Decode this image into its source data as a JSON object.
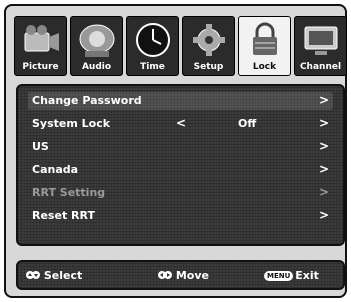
{
  "tabs": [
    {
      "label": "Picture",
      "icon": "picture-icon",
      "active": false
    },
    {
      "label": "Audio",
      "icon": "audio-icon",
      "active": false
    },
    {
      "label": "Time",
      "icon": "clock-icon",
      "active": false
    },
    {
      "label": "Setup",
      "icon": "setup-icon",
      "active": false
    },
    {
      "label": "Lock",
      "icon": "lock-icon",
      "active": true
    },
    {
      "label": "Channel",
      "icon": "channel-icon",
      "active": false
    }
  ],
  "menu": {
    "items": [
      {
        "label": "Change Password",
        "arrow": ">"
      },
      {
        "label": "System Lock",
        "left": "<",
        "value": "Off",
        "arrow": ">"
      },
      {
        "label": "US",
        "arrow": ">"
      },
      {
        "label": "Canada",
        "arrow": ">"
      },
      {
        "label": "RRT Setting",
        "arrow": ">",
        "disabled": true
      },
      {
        "label": "Reset RRT",
        "arrow": ">"
      }
    ]
  },
  "footer": {
    "select_label": "Select",
    "move_label": "Move",
    "menu_badge": "MENU",
    "exit_label": "Exit"
  }
}
